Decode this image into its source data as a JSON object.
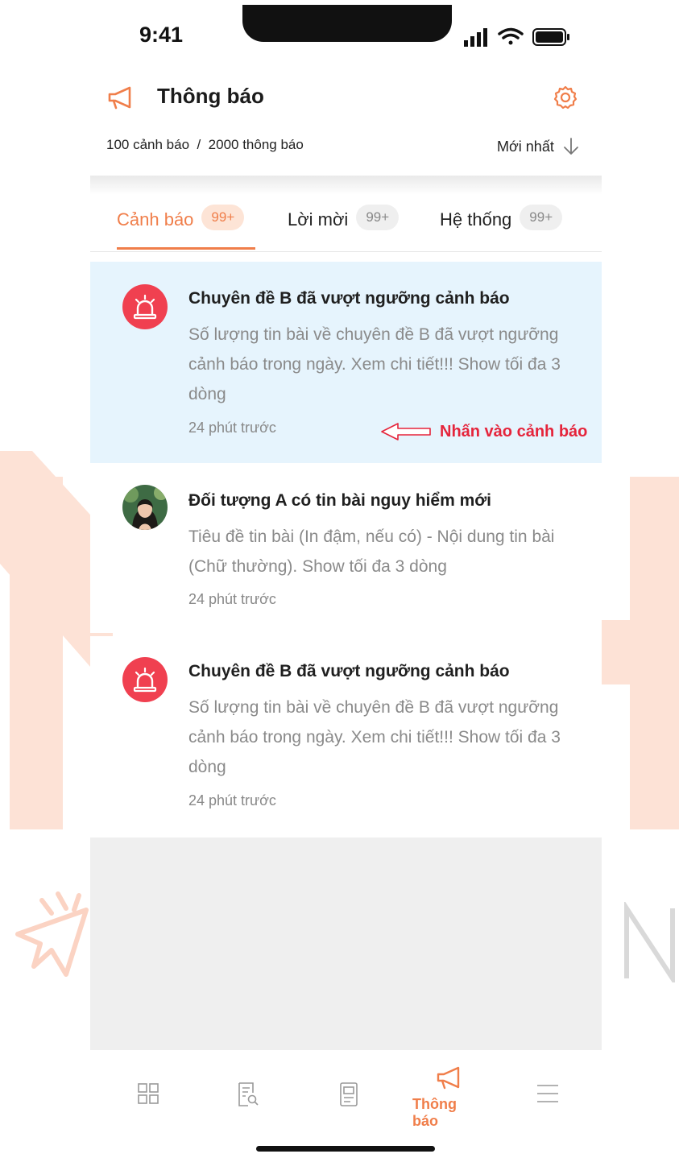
{
  "status_bar": {
    "time": "9:41"
  },
  "header": {
    "title": "Thông báo",
    "counts": "100 cảnh báo  /  2000 thông báo",
    "sort_label": "Mới nhất"
  },
  "tabs": [
    {
      "label": "Cảnh báo",
      "badge": "99+",
      "active": true
    },
    {
      "label": "Lời mời",
      "badge": "99+",
      "active": false
    },
    {
      "label": "Hệ thống",
      "badge": "99+",
      "active": false
    }
  ],
  "notifications": [
    {
      "title": "Chuyên đề B đã vượt ngưỡng cảnh báo",
      "body": "Số lượng tin bài về chuyên đề B đã vượt ngưỡng cảnh báo trong ngày. Xem chi tiết!!! Show tối đa 3 dòng",
      "time": "24 phút trước",
      "icon": "alarm-siren-icon"
    },
    {
      "title": "Đối tượng A có tin bài nguy hiểm mới",
      "body": "Tiêu đề tin bài (In đậm, nếu có) - Nội dung tin bài (Chữ thường). Show tối đa 3 dòng",
      "time": "24 phút trước",
      "icon": "user-avatar"
    },
    {
      "title": "Chuyên đề B đã vượt ngưỡng cảnh báo",
      "body": "Số lượng tin bài về chuyên đề B đã vượt ngưỡng cảnh báo trong ngày. Xem chi tiết!!! Show tối đa 3 dòng",
      "time": "24 phút trước",
      "icon": "alarm-siren-icon"
    }
  ],
  "annotation": {
    "text": "Nhấn vào cảnh báo"
  },
  "bottom_nav": {
    "items": [
      "dashboard-icon",
      "report-search-icon",
      "document-icon",
      "megaphone-icon",
      "menu-icon"
    ],
    "active_label": "Thông báo"
  },
  "colors": {
    "accent": "#f07e4a",
    "highlight": "#e6f4fd",
    "alert_red": "#f04050",
    "annotation_red": "#e5243b"
  }
}
